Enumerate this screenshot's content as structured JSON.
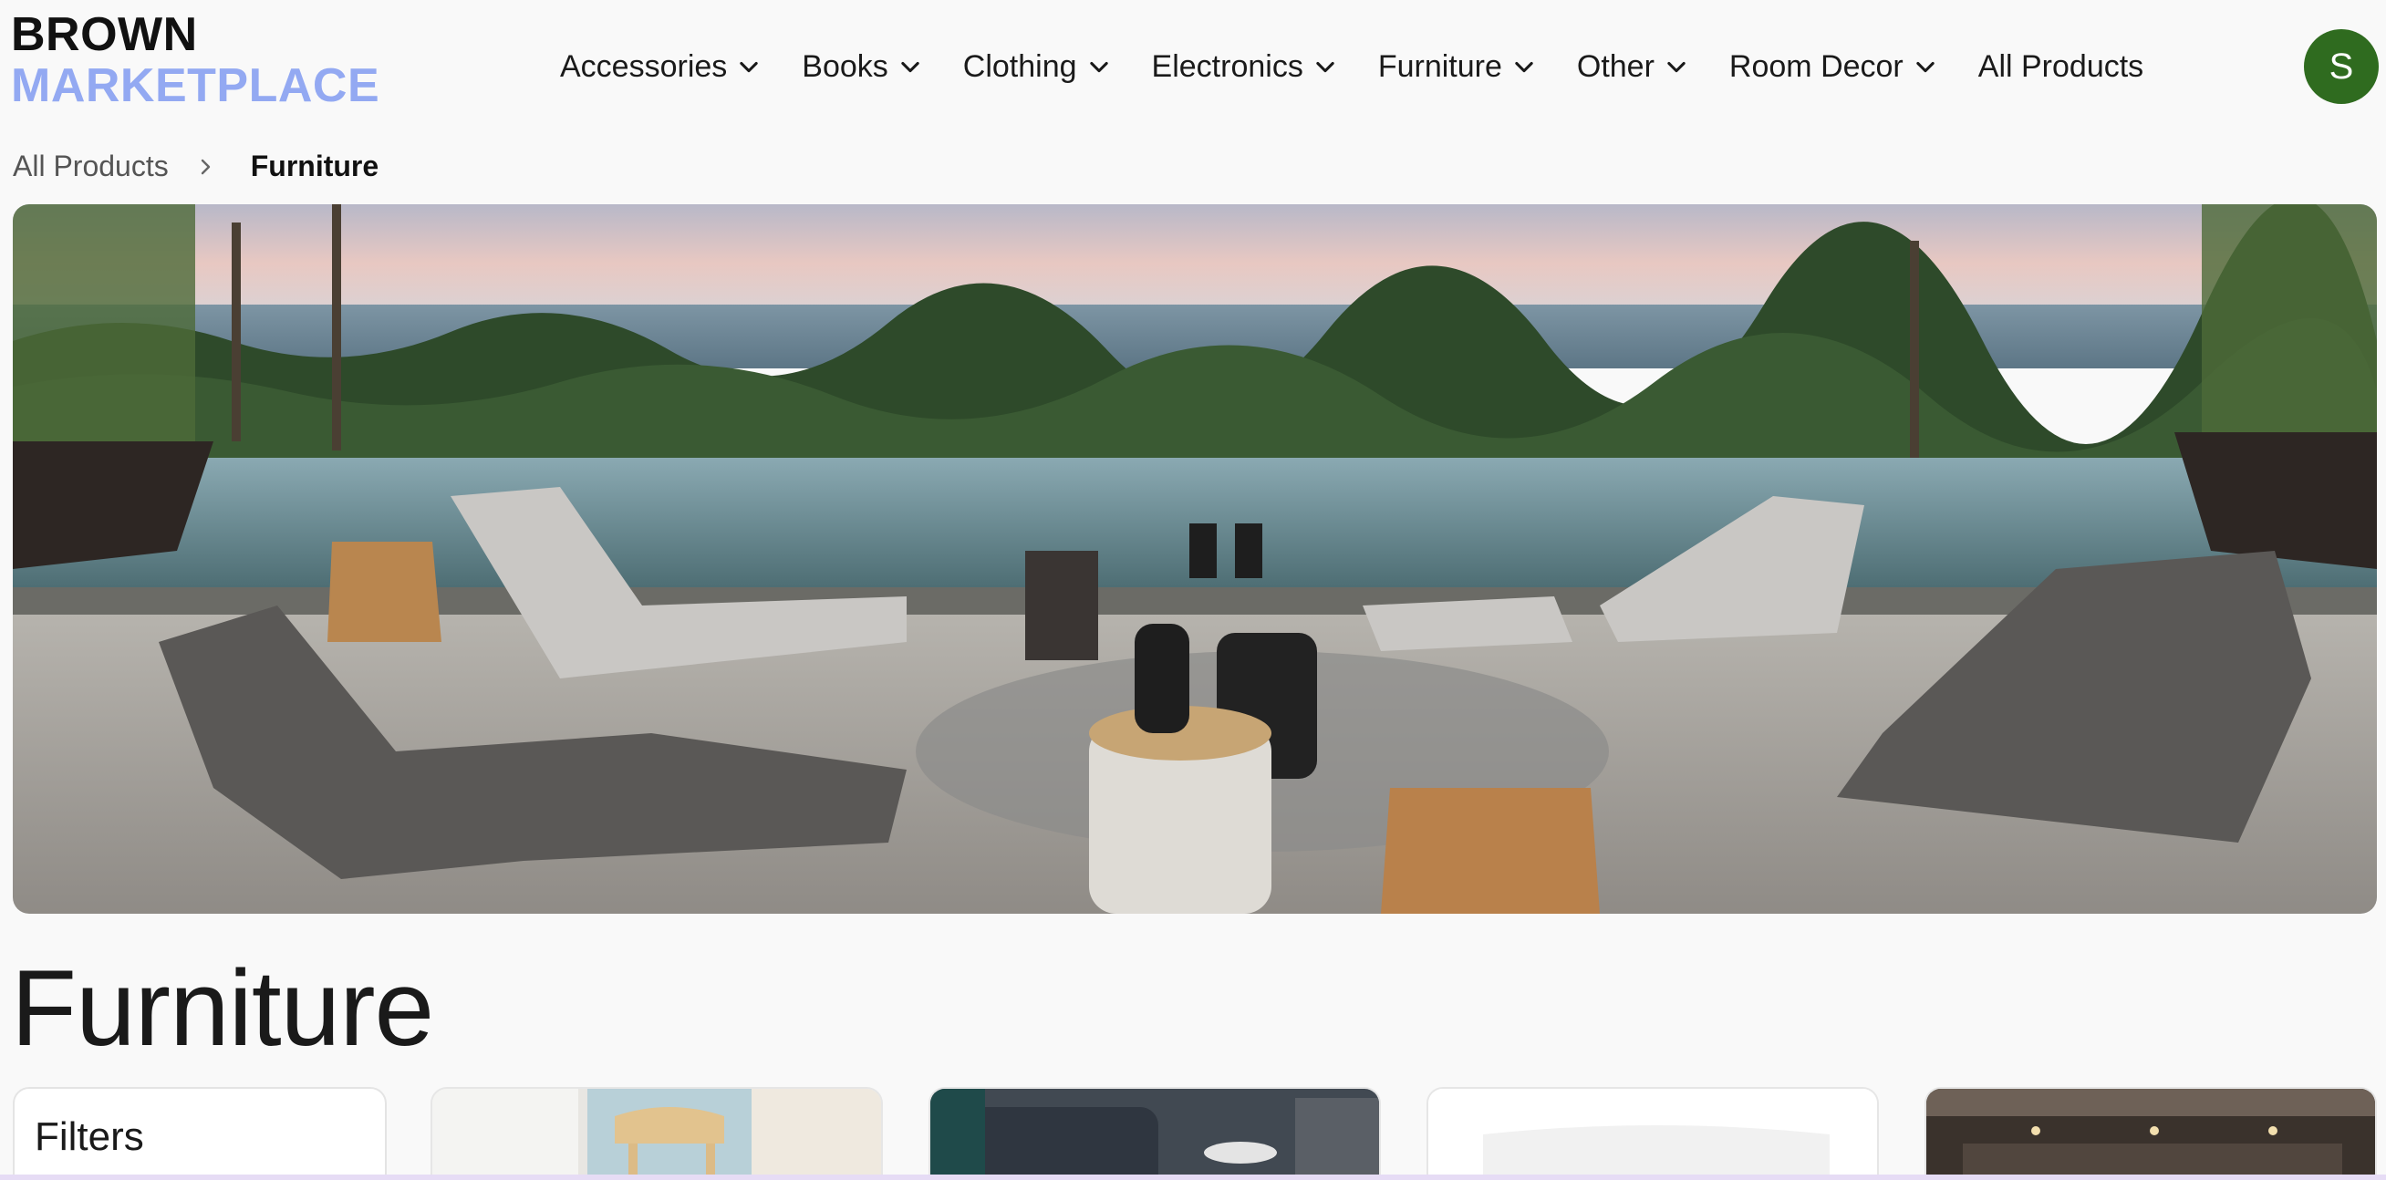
{
  "brand": {
    "line1": "BROWN",
    "line2": "MARKETPLACE"
  },
  "nav": {
    "items": [
      {
        "label": "Accessories",
        "has_dropdown": true
      },
      {
        "label": "Books",
        "has_dropdown": true
      },
      {
        "label": "Clothing",
        "has_dropdown": true
      },
      {
        "label": "Electronics",
        "has_dropdown": true
      },
      {
        "label": "Furniture",
        "has_dropdown": true
      },
      {
        "label": "Other",
        "has_dropdown": true
      },
      {
        "label": "Room Decor",
        "has_dropdown": true
      },
      {
        "label": "All Products",
        "has_dropdown": false
      }
    ]
  },
  "user": {
    "initial": "S",
    "avatar_color": "#2f6b1f"
  },
  "breadcrumb": {
    "parent": "All Products",
    "current": "Furniture"
  },
  "hero": {
    "icon": "outdoor-furniture-banner-image"
  },
  "page": {
    "title": "Furniture"
  },
  "filters": {
    "title": "Filters"
  },
  "colors": {
    "accent": "#93a9f2",
    "background": "#f9f9f9"
  }
}
